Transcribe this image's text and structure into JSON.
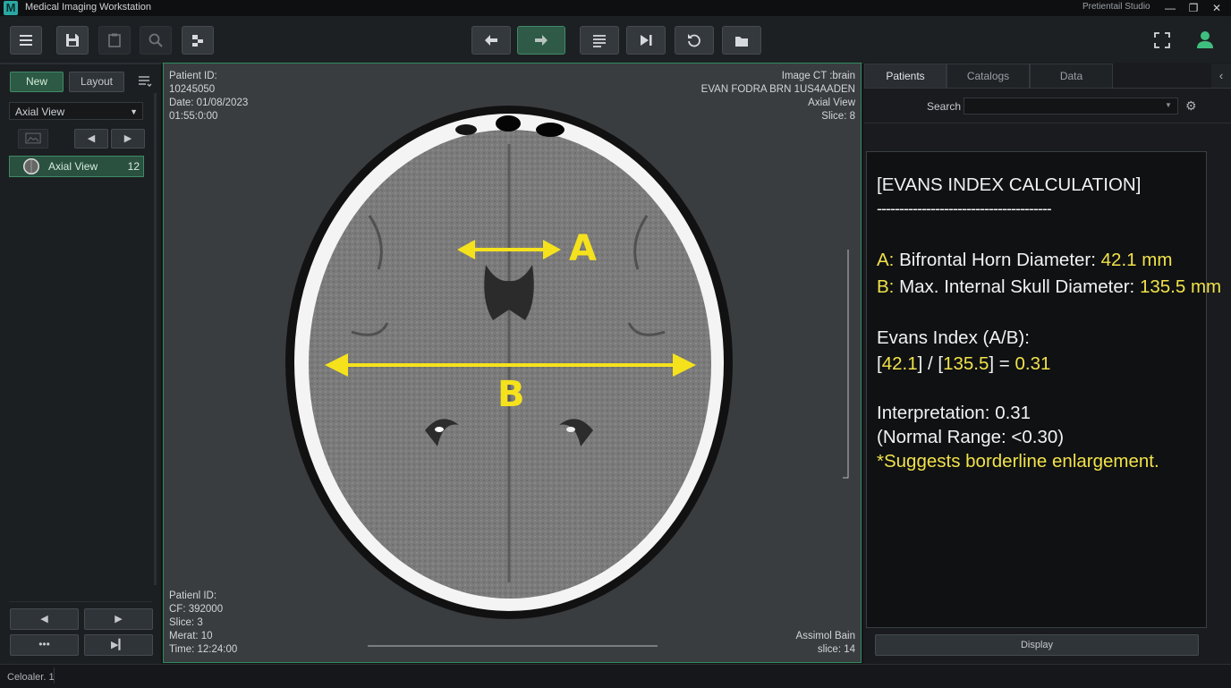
{
  "window": {
    "logo": "M",
    "title": "Medical Imaging Workstation",
    "studio": "Pretientail Studio",
    "controls": {
      "minimize": "—",
      "maximize": "❐",
      "close": "✕"
    }
  },
  "toolbar": {
    "icons": [
      "menu-icon",
      "save-icon",
      "clipboard-icon",
      "search-icon",
      "tools-icon",
      "arrow-left-icon",
      "arrow-right-icon",
      "list-icon",
      "skip-end-icon",
      "undo-icon",
      "folder-icon",
      "fullscreen-icon",
      "user-icon"
    ]
  },
  "left_panel": {
    "new_label": "New",
    "layout_label": "Layout",
    "view_select": "Axial View",
    "series": {
      "label": "Axial View",
      "count": "12"
    }
  },
  "viewport": {
    "top_left": {
      "line1": "Patient ID:",
      "line2": "10245050",
      "line3": "Date: 01/08/2023",
      "line4": "01:55:0:00"
    },
    "top_right": {
      "line1": "Image CT :brain",
      "line2": "EVAN FODRA BRN 1US4AADEN",
      "line3": "Axial View",
      "line4": "Slice: 8"
    },
    "bottom_left": {
      "line1": "Patienl ID:",
      "line2": "CF: 392000",
      "line3": "Slice: 3",
      "line4": "Merat: 10",
      "line5": "Time: 12:24:00"
    },
    "bottom_right": {
      "line1": "Assimol Bain",
      "line2": "slice: 14"
    },
    "label_a": "A",
    "label_b": "B"
  },
  "right_panel": {
    "tabs": [
      "Patients",
      "Catalogs",
      "Data"
    ],
    "active_tab": 0,
    "search_label": "Search",
    "search_value": "",
    "calc": {
      "heading": "[EVANS INDEX CALCULATION]",
      "divider": "---------------------------------------",
      "a_key": "A:",
      "a_text": " Bifrontal Horn Diameter: ",
      "a_value": "42.1 mm",
      "b_key": "B:",
      "b_text": " Max. Internal Skull Diameter: ",
      "b_value": "135.5 mm",
      "evans_label": "Evans Index (A/B):",
      "f_open1": "[",
      "f_num1": "42.1",
      "f_mid": "] / [",
      "f_num2": "135.5",
      "f_close": "] = ",
      "f_result": "0.31",
      "interp": "Interpretation: 0.31",
      "normal": "(Normal Range: <0.30)",
      "suggest": "*Suggests borderline enlargement."
    },
    "display_label": "Display"
  },
  "status": {
    "text": "Celoaler. 1"
  },
  "colors": {
    "accent_green": "#3f8a68",
    "highlight_yellow": "#f1e24a",
    "panel": "#1c1f22"
  }
}
